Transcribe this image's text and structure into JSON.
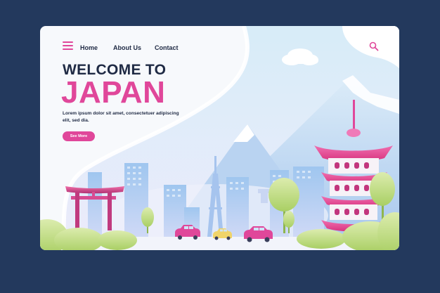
{
  "nav": {
    "home": "Home",
    "about": "About Us",
    "contact": "Contact"
  },
  "hero": {
    "welcome": "WELCOME TO",
    "country": "JAPAN",
    "body": "Lorem ipsum dolor sit amet, consectetuer adipiscing elit, sed dia.",
    "button": "See More"
  },
  "icons": {
    "menu": "menu-icon",
    "search": "search-icon"
  },
  "colors": {
    "accent": "#e0479a",
    "frame": "#23395d",
    "text": "#1f2a44"
  }
}
